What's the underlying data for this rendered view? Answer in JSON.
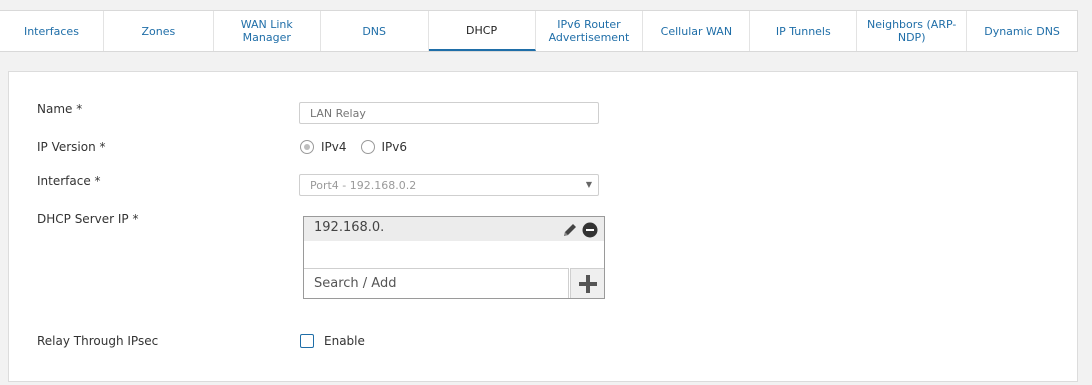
{
  "tabs": [
    {
      "label": "Interfaces",
      "active": false
    },
    {
      "label": "Zones",
      "active": false
    },
    {
      "label": "WAN Link Manager",
      "active": false
    },
    {
      "label": "DNS",
      "active": false
    },
    {
      "label": "DHCP",
      "active": true
    },
    {
      "label": "IPv6 Router Advertisement",
      "active": false
    },
    {
      "label": "Cellular WAN",
      "active": false
    },
    {
      "label": "IP Tunnels",
      "active": false
    },
    {
      "label": "Neighbors (ARP-NDP)",
      "active": false
    },
    {
      "label": "Dynamic DNS",
      "active": false
    }
  ],
  "form": {
    "name_label": "Name *",
    "name_placeholder": "LAN Relay",
    "ip_version_label": "IP Version *",
    "ip_version_options": [
      "IPv4",
      "IPv6"
    ],
    "ip_version_selected": "IPv4",
    "interface_label": "Interface *",
    "interface_value": "Port4 - 192.168.0.2",
    "dhcp_server_label": "DHCP Server IP *",
    "dhcp_server_items": [
      "192.168.0."
    ],
    "search_placeholder": "Search / Add",
    "relay_label": "Relay Through IPsec",
    "relay_checkbox_label": "Enable",
    "relay_checked": false
  },
  "icons": {
    "edit": "pencil-icon",
    "remove": "minus-circle-icon",
    "add": "plus-icon",
    "dropdown": "caret-down-icon"
  },
  "colors": {
    "accent": "#1f6ea8",
    "background": "#f2f2f2",
    "panel": "#ffffff"
  }
}
